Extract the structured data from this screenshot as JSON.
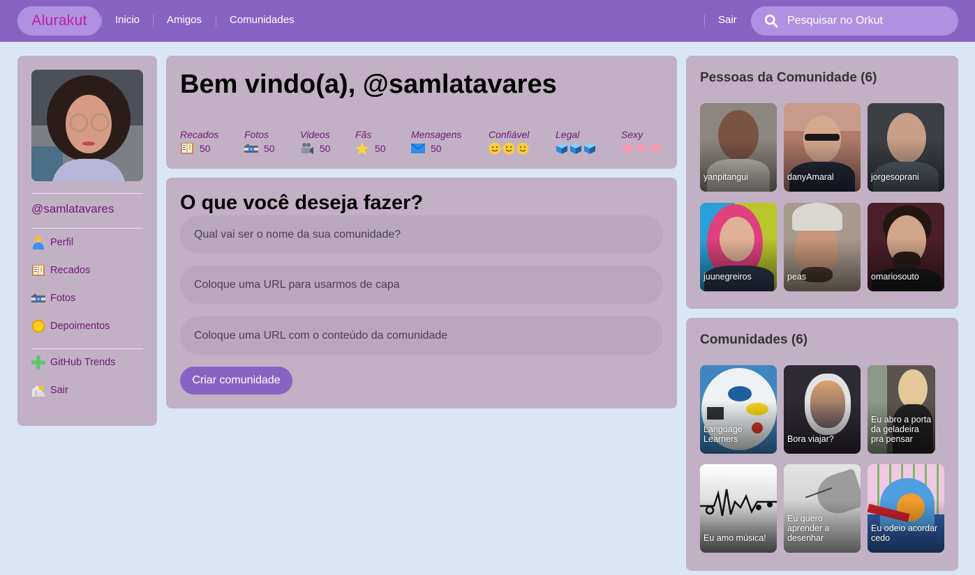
{
  "header": {
    "logo": "Alurakut",
    "nav": [
      {
        "label": "Inicio"
      },
      {
        "label": "Amigos"
      },
      {
        "label": "Comunidades"
      }
    ],
    "logout_label": "Sair",
    "search_placeholder": "Pesquisar no Orkut",
    "search_icon": "search-icon"
  },
  "profile": {
    "username": "@samlatavares",
    "menu": [
      {
        "label": "Perfil",
        "icon": "user-icon"
      },
      {
        "label": "Recados",
        "icon": "notebook-icon"
      },
      {
        "label": "Fotos",
        "icon": "camera-icon"
      },
      {
        "label": "Depoimentos",
        "icon": "sun-icon"
      }
    ],
    "menu_secondary": [
      {
        "label": "GitHub Trends",
        "icon": "plus-icon"
      },
      {
        "label": "Sair",
        "icon": "logout-house-icon"
      }
    ]
  },
  "welcome": {
    "title": "Bem vindo(a), @samlatavares",
    "stats": [
      {
        "label": "Recados",
        "icon": "notebook-icon",
        "value": "50"
      },
      {
        "label": "Fotos",
        "icon": "camera-icon",
        "value": "50"
      },
      {
        "label": "Videos",
        "icon": "video-camera-icon",
        "value": "50"
      },
      {
        "label": "Fãs",
        "icon": "star-icon",
        "value": "50"
      },
      {
        "label": "Mensagens",
        "icon": "envelope-icon",
        "value": "50"
      }
    ],
    "ratings": [
      {
        "label": "Confiável",
        "icon": "smiley-icon",
        "count": 3
      },
      {
        "label": "Legal",
        "icon": "cube-icon",
        "count": 3
      },
      {
        "label": "Sexy",
        "icon": "heart-icon",
        "count": 3
      }
    ]
  },
  "create_community": {
    "title": "O que você deseja fazer?",
    "fields": [
      {
        "placeholder": "Qual vai ser o nome da sua comunidade?",
        "value": ""
      },
      {
        "placeholder": "Coloque uma URL para usarmos de capa",
        "value": ""
      },
      {
        "placeholder": "Coloque uma URL com o conteúdo da comunidade",
        "value": ""
      }
    ],
    "submit_label": "Criar comunidade"
  },
  "people": {
    "title": "Pessoas da Comunidade (6)",
    "items": [
      {
        "name": "yanpitangui"
      },
      {
        "name": "danyAmaral"
      },
      {
        "name": "jorgesoprani"
      },
      {
        "name": "juunegreiros"
      },
      {
        "name": "peas"
      },
      {
        "name": "omariosouto"
      }
    ]
  },
  "communities": {
    "title": "Comunidades (6)",
    "items": [
      {
        "name": "Language Learners"
      },
      {
        "name": "Bora viajar?"
      },
      {
        "name": "Eu abro a porta da geladeira pra pensar"
      },
      {
        "name": "Eu amo música!"
      },
      {
        "name": "Eu quero aprender a desenhar"
      },
      {
        "name": "Eu odeio acordar cedo"
      }
    ]
  },
  "colors": {
    "header_bg": "#8863c4",
    "logo_pill": "#ae91e0",
    "logo_text": "#c3209d",
    "page_bg": "#d9e6f6",
    "box_bg": "#c2b0c4",
    "link_text": "#6f1a7a",
    "button_bg": "#8863c4"
  }
}
